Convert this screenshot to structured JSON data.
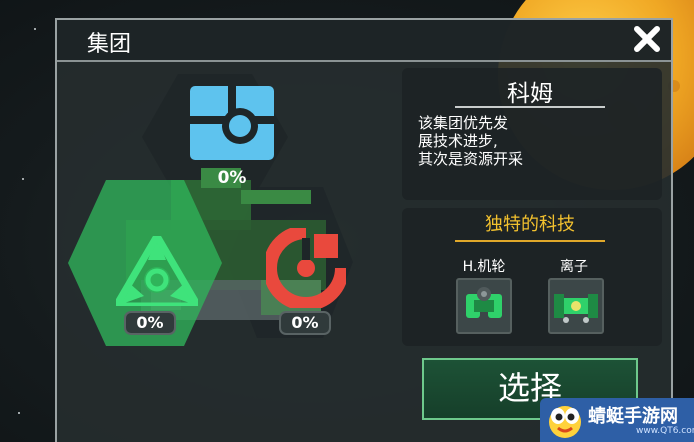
{
  "dialog": {
    "title": "集团",
    "close_icon": "close-x-icon"
  },
  "factions": [
    {
      "name": "blue",
      "icon": "blue-faction-icon",
      "color": "#5ec3ee",
      "percent": "0%"
    },
    {
      "name": "green",
      "icon": "green-faction-icon",
      "color": "#2fd16a",
      "percent": "0%",
      "selected": true
    },
    {
      "name": "red",
      "icon": "red-faction-icon",
      "color": "#e9493d",
      "percent": "0%"
    }
  ],
  "leader": {
    "name": "科姆",
    "description": "该集团优先发\n展技术进步,\n其次是资源开采"
  },
  "tech": {
    "title": "独特的科技",
    "items": [
      {
        "label": "H.机轮",
        "icon": "wheel-tech-icon"
      },
      {
        "label": "离子",
        "icon": "ion-tech-icon"
      }
    ]
  },
  "select_button": {
    "label": "选择"
  },
  "watermark": {
    "text": "蜻蜓手游网",
    "url": "www.QT6.com"
  }
}
